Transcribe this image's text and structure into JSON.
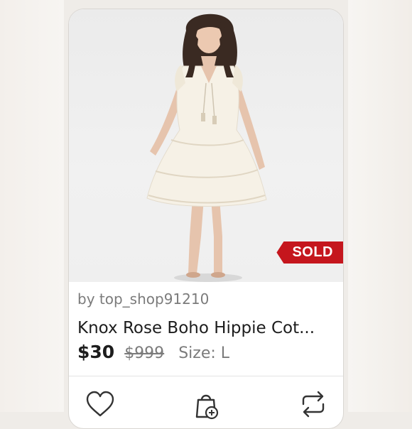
{
  "listing": {
    "seller_line": "by top_shop91210",
    "title": "Knox Rose Boho Hippie Cot...",
    "price": "$30",
    "original_price": "$999",
    "size_line": "Size: L",
    "status_badge": "SOLD",
    "badge_color": "#c5161d"
  },
  "actions": {
    "like_icon": "heart-icon",
    "bundle_icon": "shopping-bag-plus-icon",
    "share_icon": "repost-icon"
  }
}
